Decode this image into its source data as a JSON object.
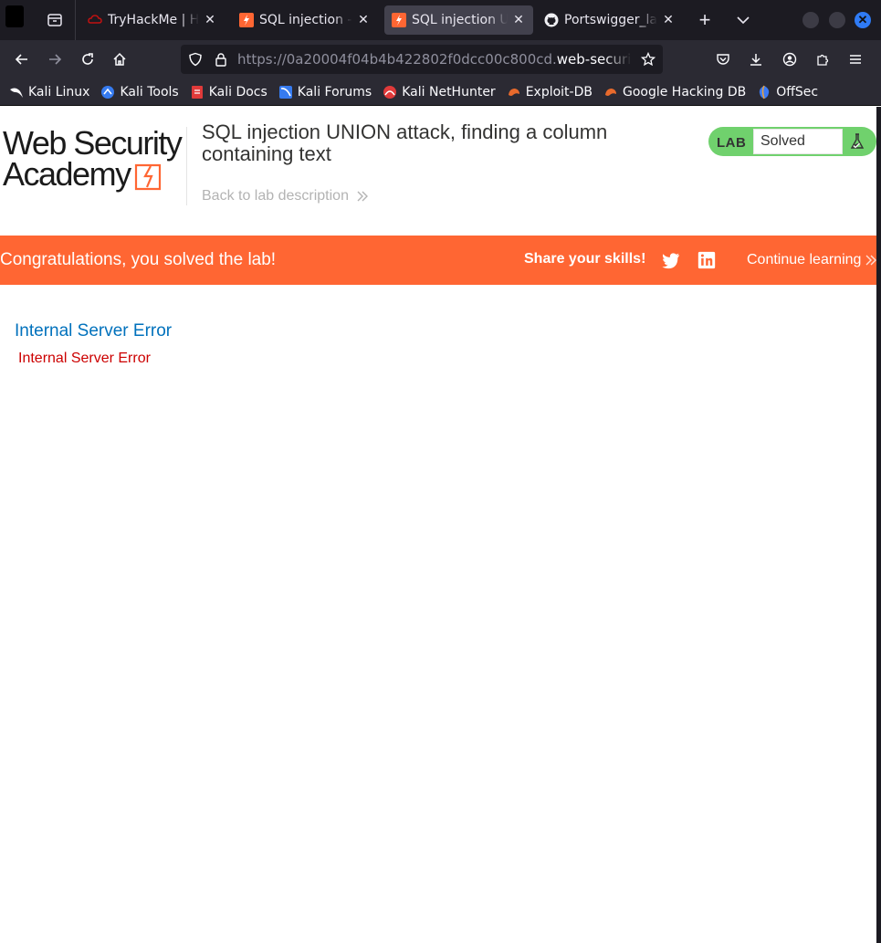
{
  "browser": {
    "tabs": [
      {
        "label": "TryHackMe | Hac",
        "icon": "tryhackme-icon",
        "active": false
      },
      {
        "label": "SQL injection - P",
        "icon": "portswigger-icon",
        "active": false
      },
      {
        "label": "SQL injection UN",
        "icon": "portswigger-icon",
        "active": true
      },
      {
        "label": "Portswigger_lab",
        "icon": "github-icon",
        "active": false
      }
    ],
    "url": {
      "prefix": "https://0a20004f04b4b422802f0dcc00c800cd.",
      "domain": "web-security-ac"
    },
    "bookmarks": [
      {
        "label": "Kali Linux",
        "icon": "kali-dragon-icon"
      },
      {
        "label": "Kali Tools",
        "icon": "kali-tools-icon"
      },
      {
        "label": "Kali Docs",
        "icon": "kali-docs-icon"
      },
      {
        "label": "Kali Forums",
        "icon": "kali-forums-icon"
      },
      {
        "label": "Kali NetHunter",
        "icon": "kali-nethunter-icon"
      },
      {
        "label": "Exploit-DB",
        "icon": "exploit-db-icon"
      },
      {
        "label": "Google Hacking DB",
        "icon": "ghdb-icon"
      },
      {
        "label": "OffSec",
        "icon": "offsec-icon"
      }
    ]
  },
  "page": {
    "logo": {
      "line1": "Web Security",
      "line2": "Academy"
    },
    "title": "SQL injection UNION attack, finding a column containing text",
    "back_link": "Back to lab description",
    "lab_badge": {
      "label": "LAB",
      "status": "Solved"
    },
    "banner": {
      "message": "Congratulations, you solved the lab!",
      "share": "Share your skills!",
      "continue": "Continue learning"
    },
    "error": {
      "title": "Internal Server Error",
      "message": "Internal Server Error"
    }
  },
  "colors": {
    "accent": "#ff6633",
    "lab_green": "#70d16d",
    "error_title": "#0071bc",
    "error_text": "#cc0000"
  }
}
